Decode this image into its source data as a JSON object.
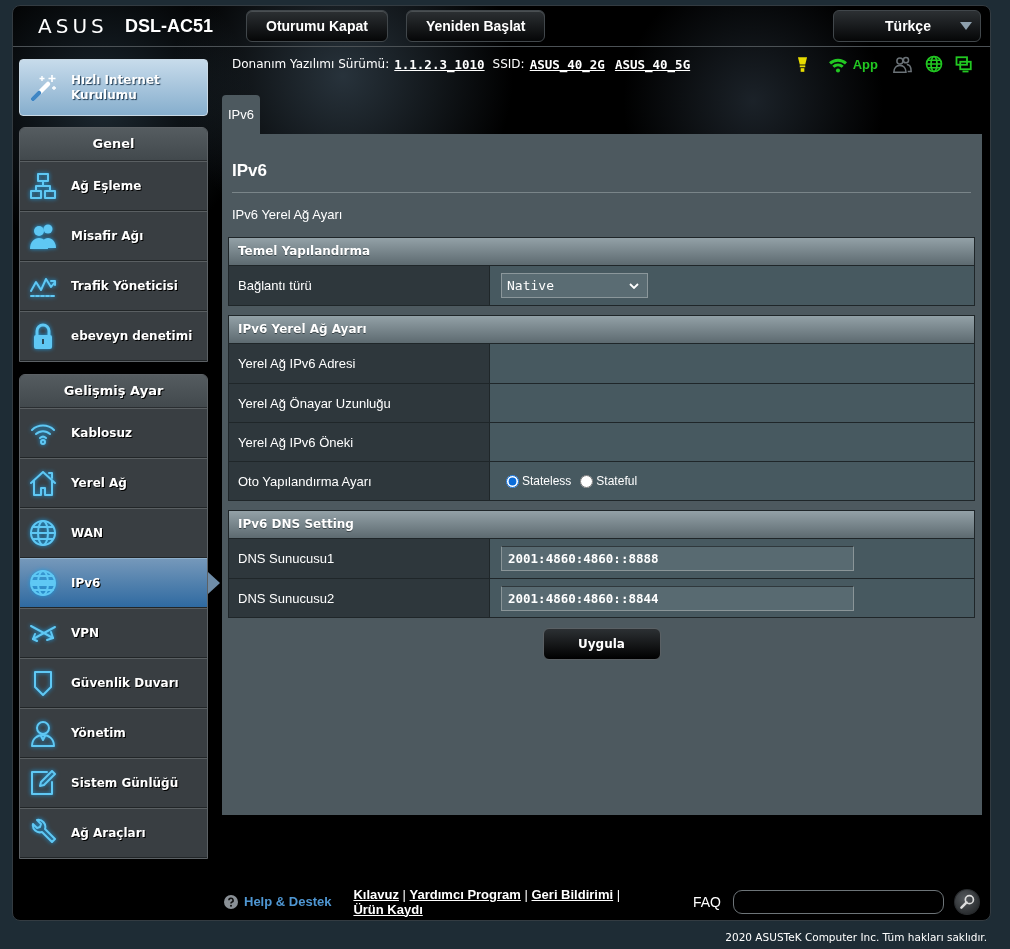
{
  "header": {
    "logo": "ASUS",
    "model": "DSL-AC51",
    "buttons": [
      "Oturumu Kapat",
      "Yeniden Başlat"
    ],
    "language": "Türkçe"
  },
  "info_bar": {
    "firmware_label": "Donanım Yazılımı Sürümü:",
    "firmware_version": "1.1.2.3_1010",
    "ssid_label": "SSID:",
    "ssids": [
      "ASUS_40_2G",
      "ASUS_40_5G"
    ],
    "status_icons": [
      {
        "kind": "bulb",
        "color": "#e8dc00"
      },
      {
        "kind": "wifi",
        "color": "#22c822",
        "label": "App"
      },
      {
        "kind": "clients",
        "color": "#6b7277"
      },
      {
        "kind": "globe",
        "color": "#22c822"
      },
      {
        "kind": "screens",
        "color": "#22c822"
      }
    ]
  },
  "sidebar": {
    "quick_setup": "Hızlı Internet Kurulumu",
    "sections": [
      {
        "title": "Genel",
        "items": [
          {
            "kind": "network",
            "label": "Ağ Eşleme",
            "selected": false
          },
          {
            "kind": "guests",
            "label": "Misafir Ağı",
            "selected": false
          },
          {
            "kind": "traffic",
            "label": "Trafik Yöneticisi",
            "selected": false
          },
          {
            "kind": "lock",
            "label": "ebeveyn denetimi",
            "selected": false
          }
        ]
      },
      {
        "title": "Gelişmiş Ayar",
        "items": [
          {
            "kind": "wifi",
            "label": "Kablosuz",
            "selected": false
          },
          {
            "kind": "house",
            "label": "Yerel Ağ",
            "selected": false
          },
          {
            "kind": "globe",
            "label": "WAN",
            "selected": false
          },
          {
            "kind": "ipv6",
            "label": "IPv6",
            "selected": true
          },
          {
            "kind": "vpn",
            "label": "VPN",
            "selected": false
          },
          {
            "kind": "shield",
            "label": "Güvenlik Duvarı",
            "selected": false
          },
          {
            "kind": "person",
            "label": "Yönetim",
            "selected": false
          },
          {
            "kind": "notepad",
            "label": "Sistem Günlüğü",
            "selected": false
          },
          {
            "kind": "wrench",
            "label": "Ağ Araçları",
            "selected": false
          }
        ]
      }
    ]
  },
  "tabs": [
    {
      "label": "IPv6",
      "selected": true
    }
  ],
  "page": {
    "title": "IPv6",
    "subtitle": "IPv6 Yerel Ağ Ayarı",
    "sections": [
      {
        "title": "Temel Yapılandırma",
        "rows": [
          {
            "label": "Bağlantı türü",
            "kind": "select",
            "value": "Native"
          }
        ]
      },
      {
        "title": "IPv6 Yerel Ağ Ayarı",
        "rows": [
          {
            "label": "Yerel Ağ IPv6 Adresi",
            "kind": "blank"
          },
          {
            "label": "Yerel Ağ Önayar Uzunluğu",
            "kind": "blank"
          },
          {
            "label": "Yerel Ağ IPv6 Öneki",
            "kind": "blank"
          },
          {
            "label": "Oto Yapılandırma Ayarı",
            "kind": "radio",
            "options": [
              {
                "label": "Stateless",
                "selected": true
              },
              {
                "label": "Stateful",
                "selected": false
              }
            ]
          }
        ]
      },
      {
        "title": "IPv6 DNS Setting",
        "rows": [
          {
            "label": "DNS Sunucusu1",
            "kind": "input",
            "value": "2001:4860:4860::8888"
          },
          {
            "label": "DNS Sunucusu2",
            "kind": "input",
            "value": "2001:4860:4860::8844"
          }
        ]
      }
    ],
    "apply_button": "Uygula"
  },
  "footer": {
    "help": "Help & Destek",
    "links": [
      "Kılavuz",
      "Yardımcı Program",
      "Geri Bildirimi",
      "Ürün Kaydı"
    ],
    "link_separator": "|",
    "faq_label": "FAQ",
    "copyright": "2020 ASUSTeK Computer Inc. Tüm hakları saklıdır."
  }
}
